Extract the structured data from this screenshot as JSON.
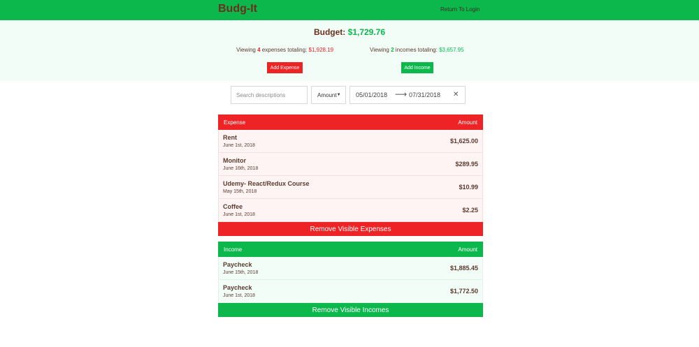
{
  "header": {
    "logo": "Budg-It",
    "login_link": "Return To Login",
    "color": "#0cb84c"
  },
  "summary": {
    "budget_label": "Budget:",
    "budget_value": "$1,729.76",
    "expenses": {
      "prefix": "Viewing",
      "count": "4",
      "middle": "expenses totaling:",
      "total": "$1,928.19"
    },
    "incomes": {
      "prefix": "Viewing",
      "count": "2",
      "middle": "incomes totaling:",
      "total": "$3,657.95"
    },
    "add_expense_label": "Add Expense",
    "add_income_label": "Add Income"
  },
  "filters": {
    "search_placeholder": "Search descriptions",
    "sort_value": "Amount",
    "start_date": "05/01/2018",
    "end_date": "07/31/2018",
    "arrow_icon": "arrow-right-icon",
    "clear_icon": "close-icon"
  },
  "expenses": {
    "col_title": "Expense",
    "col_amount": "Amount",
    "color": "#ee2326",
    "rows": [
      {
        "title": "Rent",
        "date": "June 1st, 2018",
        "amount": "$1,625.00"
      },
      {
        "title": "Monitor",
        "date": "June 16th, 2018",
        "amount": "$289.95"
      },
      {
        "title": "Udemy- React/Redux Course",
        "date": "May 15th, 2018",
        "amount": "$10.99"
      },
      {
        "title": "Coffee",
        "date": "June 1st, 2018",
        "amount": "$2.25"
      }
    ],
    "remove_label": "Remove Visible Expenses"
  },
  "incomes": {
    "col_title": "Income",
    "col_amount": "Amount",
    "color": "#0cb84c",
    "rows": [
      {
        "title": "Paycheck",
        "date": "June 15th, 2018",
        "amount": "$1,885.45"
      },
      {
        "title": "Paycheck",
        "date": "June 1st, 2018",
        "amount": "$1,772.50"
      }
    ],
    "remove_label": "Remove Visible Incomes"
  }
}
